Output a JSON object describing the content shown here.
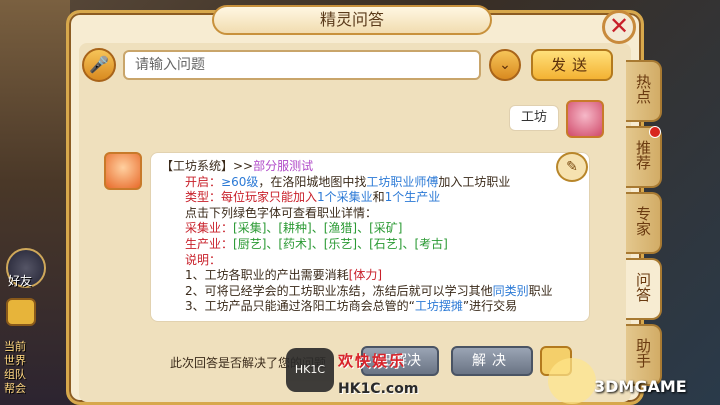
{
  "window": {
    "title": "精灵问答",
    "close_label": "✕"
  },
  "search": {
    "placeholder": "请输入问题",
    "send_label": "发送",
    "mic_icon": "🎤",
    "dropdown_icon": "⌄"
  },
  "side_tabs": [
    {
      "label": "热点"
    },
    {
      "label": "推荐"
    },
    {
      "label": "专家"
    },
    {
      "label": "问答"
    },
    {
      "label": "助手"
    }
  ],
  "left_ui": {
    "friend_label": "好友",
    "chat_lines": [
      "当前",
      "世界",
      "组队",
      "帮会"
    ]
  },
  "user_msg": {
    "text": "工坊"
  },
  "answer": {
    "line1_a": "【工坊系统】>>",
    "line1_b": "部分服测试",
    "line2_a": "开启：",
    "line2_b": "≥60级",
    "line2_c": "，在洛阳城地图中找",
    "line2_d": "工坊职业师傅",
    "line2_e": "加入工坊职业",
    "line3_a": "类型：每位玩家只能加入",
    "line3_b": "1个采集业",
    "line3_c": "和",
    "line3_d": "1个生产业",
    "line4": "点击下列绿色字体可查看职业详情：",
    "line5_a": "采集业：",
    "line5_b": "[采集]、[耕种]、[渔猎]、[采矿]",
    "line6_a": "生产业：",
    "line6_b": "[厨艺]、[药术]、[乐艺]、[石艺]、[考古]",
    "line7": "说明：",
    "line8_a": "1、工坊各职业的产出需要消耗",
    "line8_b": "[体力]",
    "line9_a": "2、可将已经学会的工坊职业冻结，冻结后就可以学习其他",
    "line9_b": "同类别",
    "line9_c": "职业",
    "line10_a": "3、工坊产品只能通过洛阳工坊商会总管的“",
    "line10_b": "工坊摆摊",
    "line10_c": "”进行交易"
  },
  "feedback": {
    "question": "此次回答是否解决了您的问题",
    "solved_label": "已解决",
    "unsolved_label": "解决"
  },
  "watermark": {
    "logo": "HK1C",
    "text": "欢快娱乐",
    "url": "HK1C.com",
    "site": "3DMGAME"
  },
  "colors": {
    "accent": "#d7a84c",
    "link_blue": "#2c7ad6",
    "green": "#2b9a34",
    "red": "#c8202a"
  }
}
